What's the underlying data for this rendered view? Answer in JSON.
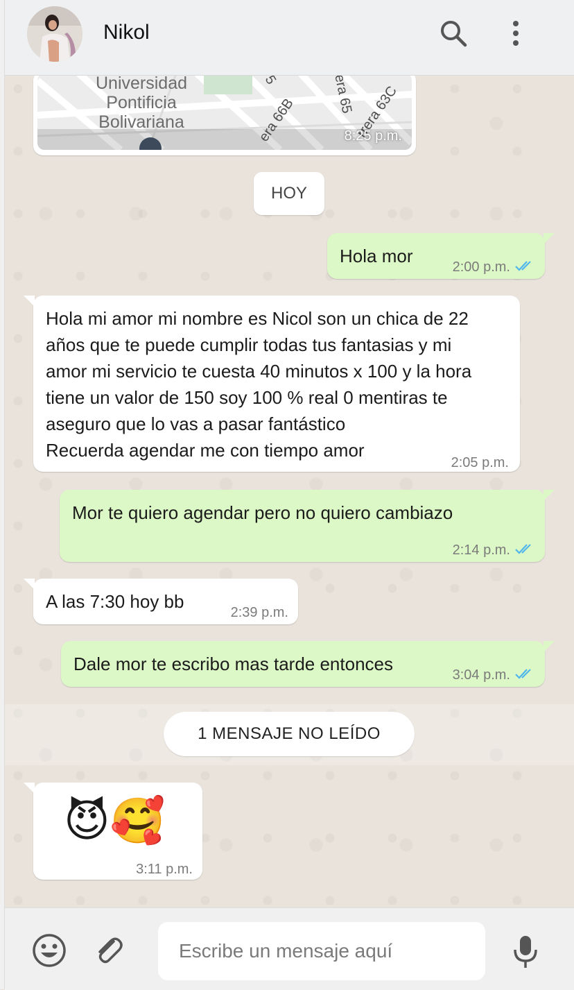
{
  "header": {
    "contact_name": "Nikol",
    "icons": [
      "search-icon",
      "more-vert-icon"
    ]
  },
  "map_message": {
    "place_label": "Universidad\nPontificia\nBolivariana",
    "streets": [
      "5",
      "era 66B",
      "era 65",
      "rrera 63C"
    ],
    "time": "8:25 p.m."
  },
  "date_divider": "HOY",
  "messages": [
    {
      "direction": "out",
      "text": "Hola mor",
      "time": "2:00 p.m.",
      "status": "read"
    },
    {
      "direction": "in",
      "text": "Hola mi amor mi nombre es Nicol son un chica de 22\naños que te puede cumplir todas tus fantasias y mi\namor mi servicio te cuesta 40 minutos x 100 y la hora\ntiene un valor de 150 soy 100 % real 0 mentiras te\naseguro que lo vas a pasar fantástico\nRecuerda agendar me con tiempo amor",
      "time": "2:05 p.m."
    },
    {
      "direction": "out",
      "text": "Mor te quiero agendar pero no quiero cambiazo",
      "time": "2:14 p.m.",
      "status": "read"
    },
    {
      "direction": "in",
      "text": "A las 7:30 hoy bb",
      "time": "2:39 p.m."
    },
    {
      "direction": "out",
      "text": "Dale mor te escribo mas tarde entonces",
      "time": "3:04 p.m.",
      "status": "read"
    }
  ],
  "unread_divider": "1 MENSAJE NO LEÍDO",
  "emoji_message": {
    "emojis": "😈🥰",
    "time": "3:11 p.m."
  },
  "footer": {
    "input_placeholder": "Escribe un mensaje aquí",
    "icons": [
      "emoji-icon",
      "attach-icon",
      "mic-icon"
    ]
  },
  "colors": {
    "outgoing": "#dcf8c6",
    "incoming": "#ffffff",
    "read_ticks": "#4fb6ec",
    "background": "#e5ddd5"
  }
}
